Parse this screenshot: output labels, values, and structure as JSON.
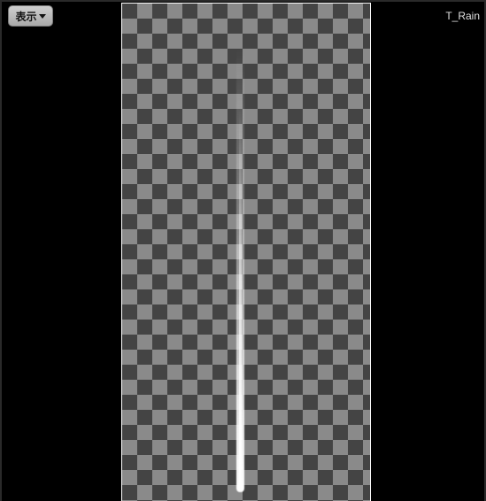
{
  "toolbar": {
    "view_menu_label": "表示"
  },
  "texture": {
    "name": "T_Rain"
  },
  "icons": {
    "view_menu_caret": "caret-down-icon"
  }
}
